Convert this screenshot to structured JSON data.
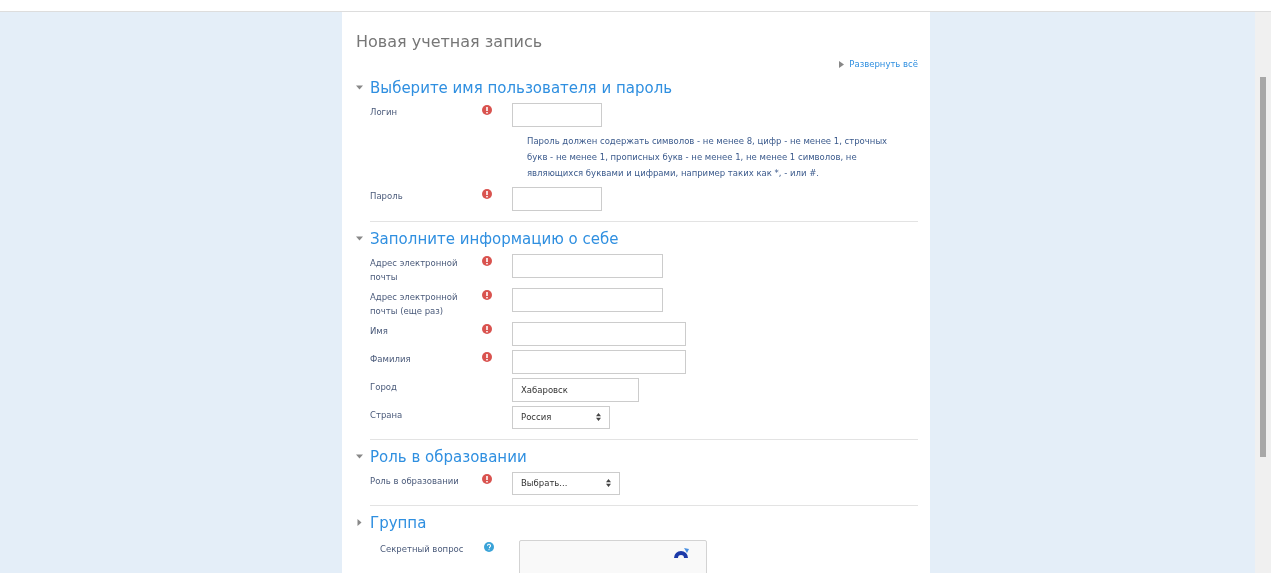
{
  "title": "Новая учетная запись",
  "expand_all": "Развернуть всё",
  "sections": [
    {
      "heading": "Выберите имя пользователя и пароль",
      "expanded": true,
      "fields": [
        {
          "kind": "short-text",
          "label": "Логин",
          "required": true
        },
        {
          "kind": "note",
          "text": "Пароль должен содержать символов - не менее 8, цифр - не менее 1, строчных букв - не менее 1, прописных букв - не менее 1, не менее 1 символов, не являющихся буквами и цифрами, например таких как *, - или #."
        },
        {
          "kind": "short-text",
          "label": "Пароль",
          "required": true
        }
      ]
    },
    {
      "heading": "Заполните информацию о себе",
      "expanded": true,
      "fields": [
        {
          "kind": "mid-text",
          "label": "Адрес электронной почты",
          "required": true
        },
        {
          "kind": "mid-text",
          "label": "Адрес электронной почты (еще раз)",
          "required": true
        },
        {
          "kind": "long-text",
          "label": "Имя",
          "required": true
        },
        {
          "kind": "long-text",
          "label": "Фамилия",
          "required": true
        },
        {
          "kind": "compact-text",
          "label": "Город",
          "required": false,
          "value": "Хабаровск"
        },
        {
          "kind": "short-select",
          "label": "Страна",
          "required": false,
          "value": "Россия"
        }
      ]
    },
    {
      "heading": "Роль в образовании",
      "expanded": true,
      "fields": [
        {
          "kind": "compact-select",
          "label": "Роль в образовании",
          "required": true,
          "value": "Выбрать..."
        }
      ]
    },
    {
      "heading": "Группа",
      "expanded": false
    },
    {
      "kind": "captcha",
      "label": "Секретный вопрос"
    }
  ]
}
